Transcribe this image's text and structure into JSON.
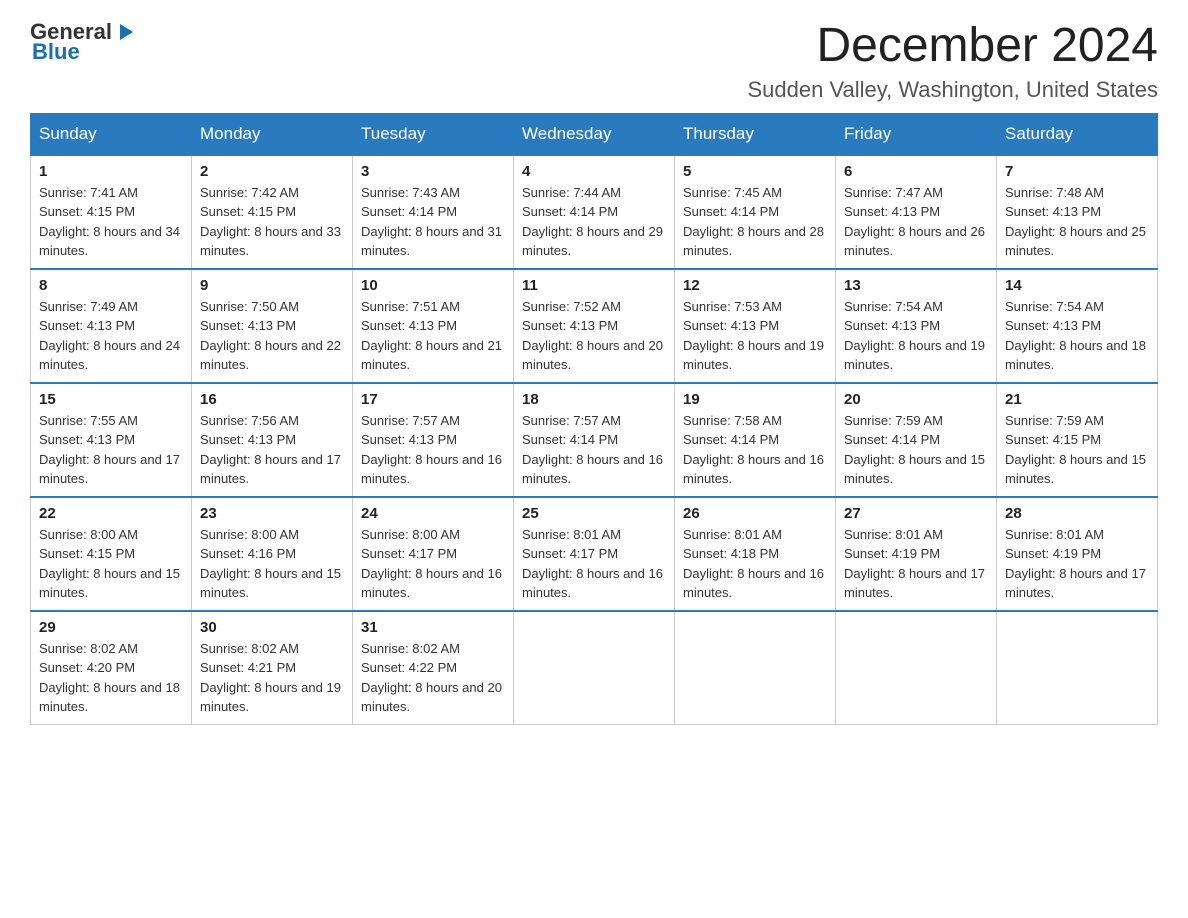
{
  "header": {
    "logo": {
      "general": "General",
      "arrow": "▶",
      "blue": "Blue"
    },
    "title": "December 2024",
    "subtitle": "Sudden Valley, Washington, United States"
  },
  "weekdays": [
    "Sunday",
    "Monday",
    "Tuesday",
    "Wednesday",
    "Thursday",
    "Friday",
    "Saturday"
  ],
  "weeks": [
    [
      {
        "day": "1",
        "sunrise": "7:41 AM",
        "sunset": "4:15 PM",
        "daylight": "8 hours and 34 minutes."
      },
      {
        "day": "2",
        "sunrise": "7:42 AM",
        "sunset": "4:15 PM",
        "daylight": "8 hours and 33 minutes."
      },
      {
        "day": "3",
        "sunrise": "7:43 AM",
        "sunset": "4:14 PM",
        "daylight": "8 hours and 31 minutes."
      },
      {
        "day": "4",
        "sunrise": "7:44 AM",
        "sunset": "4:14 PM",
        "daylight": "8 hours and 29 minutes."
      },
      {
        "day": "5",
        "sunrise": "7:45 AM",
        "sunset": "4:14 PM",
        "daylight": "8 hours and 28 minutes."
      },
      {
        "day": "6",
        "sunrise": "7:47 AM",
        "sunset": "4:13 PM",
        "daylight": "8 hours and 26 minutes."
      },
      {
        "day": "7",
        "sunrise": "7:48 AM",
        "sunset": "4:13 PM",
        "daylight": "8 hours and 25 minutes."
      }
    ],
    [
      {
        "day": "8",
        "sunrise": "7:49 AM",
        "sunset": "4:13 PM",
        "daylight": "8 hours and 24 minutes."
      },
      {
        "day": "9",
        "sunrise": "7:50 AM",
        "sunset": "4:13 PM",
        "daylight": "8 hours and 22 minutes."
      },
      {
        "day": "10",
        "sunrise": "7:51 AM",
        "sunset": "4:13 PM",
        "daylight": "8 hours and 21 minutes."
      },
      {
        "day": "11",
        "sunrise": "7:52 AM",
        "sunset": "4:13 PM",
        "daylight": "8 hours and 20 minutes."
      },
      {
        "day": "12",
        "sunrise": "7:53 AM",
        "sunset": "4:13 PM",
        "daylight": "8 hours and 19 minutes."
      },
      {
        "day": "13",
        "sunrise": "7:54 AM",
        "sunset": "4:13 PM",
        "daylight": "8 hours and 19 minutes."
      },
      {
        "day": "14",
        "sunrise": "7:54 AM",
        "sunset": "4:13 PM",
        "daylight": "8 hours and 18 minutes."
      }
    ],
    [
      {
        "day": "15",
        "sunrise": "7:55 AM",
        "sunset": "4:13 PM",
        "daylight": "8 hours and 17 minutes."
      },
      {
        "day": "16",
        "sunrise": "7:56 AM",
        "sunset": "4:13 PM",
        "daylight": "8 hours and 17 minutes."
      },
      {
        "day": "17",
        "sunrise": "7:57 AM",
        "sunset": "4:13 PM",
        "daylight": "8 hours and 16 minutes."
      },
      {
        "day": "18",
        "sunrise": "7:57 AM",
        "sunset": "4:14 PM",
        "daylight": "8 hours and 16 minutes."
      },
      {
        "day": "19",
        "sunrise": "7:58 AM",
        "sunset": "4:14 PM",
        "daylight": "8 hours and 16 minutes."
      },
      {
        "day": "20",
        "sunrise": "7:59 AM",
        "sunset": "4:14 PM",
        "daylight": "8 hours and 15 minutes."
      },
      {
        "day": "21",
        "sunrise": "7:59 AM",
        "sunset": "4:15 PM",
        "daylight": "8 hours and 15 minutes."
      }
    ],
    [
      {
        "day": "22",
        "sunrise": "8:00 AM",
        "sunset": "4:15 PM",
        "daylight": "8 hours and 15 minutes."
      },
      {
        "day": "23",
        "sunrise": "8:00 AM",
        "sunset": "4:16 PM",
        "daylight": "8 hours and 15 minutes."
      },
      {
        "day": "24",
        "sunrise": "8:00 AM",
        "sunset": "4:17 PM",
        "daylight": "8 hours and 16 minutes."
      },
      {
        "day": "25",
        "sunrise": "8:01 AM",
        "sunset": "4:17 PM",
        "daylight": "8 hours and 16 minutes."
      },
      {
        "day": "26",
        "sunrise": "8:01 AM",
        "sunset": "4:18 PM",
        "daylight": "8 hours and 16 minutes."
      },
      {
        "day": "27",
        "sunrise": "8:01 AM",
        "sunset": "4:19 PM",
        "daylight": "8 hours and 17 minutes."
      },
      {
        "day": "28",
        "sunrise": "8:01 AM",
        "sunset": "4:19 PM",
        "daylight": "8 hours and 17 minutes."
      }
    ],
    [
      {
        "day": "29",
        "sunrise": "8:02 AM",
        "sunset": "4:20 PM",
        "daylight": "8 hours and 18 minutes."
      },
      {
        "day": "30",
        "sunrise": "8:02 AM",
        "sunset": "4:21 PM",
        "daylight": "8 hours and 19 minutes."
      },
      {
        "day": "31",
        "sunrise": "8:02 AM",
        "sunset": "4:22 PM",
        "daylight": "8 hours and 20 minutes."
      },
      null,
      null,
      null,
      null
    ]
  ]
}
